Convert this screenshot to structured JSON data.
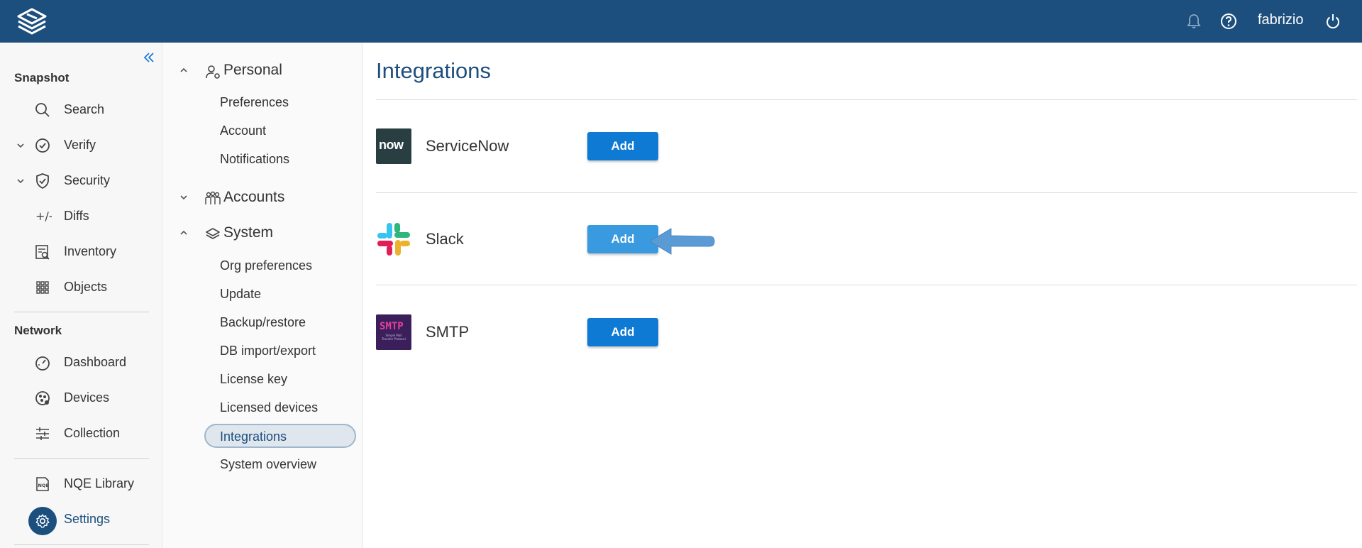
{
  "topbar": {
    "logo_icon": "stack-logo-icon",
    "user_name": "fabrizio",
    "icons": [
      "bell-icon",
      "help-icon",
      "power-icon"
    ]
  },
  "leftnav": {
    "snapshot_title": "Snapshot",
    "snapshot_items": [
      {
        "label": "Search",
        "icon": "search-icon"
      },
      {
        "label": "Verify",
        "icon": "check-circle-icon"
      },
      {
        "label": "Security",
        "icon": "shield-check-icon"
      },
      {
        "label": "Diffs",
        "icon": "diff-icon"
      },
      {
        "label": "Inventory",
        "icon": "inventory-icon"
      },
      {
        "label": "Objects",
        "icon": "grid-icon"
      }
    ],
    "network_title": "Network",
    "network_items": [
      {
        "label": "Dashboard",
        "icon": "gauge-icon"
      },
      {
        "label": "Devices",
        "icon": "devices-icon"
      },
      {
        "label": "Collection",
        "icon": "sliders-icon"
      }
    ],
    "bottom_items": [
      {
        "label": "NQE Library",
        "icon": "nqe-icon"
      },
      {
        "label": "Settings",
        "icon": "gear-icon"
      }
    ]
  },
  "subnav": {
    "personal": {
      "label": "Personal",
      "items": [
        "Preferences",
        "Account",
        "Notifications"
      ]
    },
    "accounts": {
      "label": "Accounts"
    },
    "system": {
      "label": "System",
      "items": [
        "Org preferences",
        "Update",
        "Backup/restore",
        "DB import/export",
        "License key",
        "Licensed devices",
        "Integrations",
        "System overview"
      ]
    }
  },
  "main": {
    "title": "Integrations",
    "integrations": [
      {
        "name": "ServiceNow",
        "button": "Add",
        "logo_text": "now"
      },
      {
        "name": "Slack",
        "button": "Add"
      },
      {
        "name": "SMTP",
        "button": "Add",
        "logo_text": "SMTP",
        "logo_subtext": "Simple Mail Transfer Protocol"
      }
    ],
    "accent": "#1c4e7e",
    "button_color": "#0f7ad3"
  }
}
